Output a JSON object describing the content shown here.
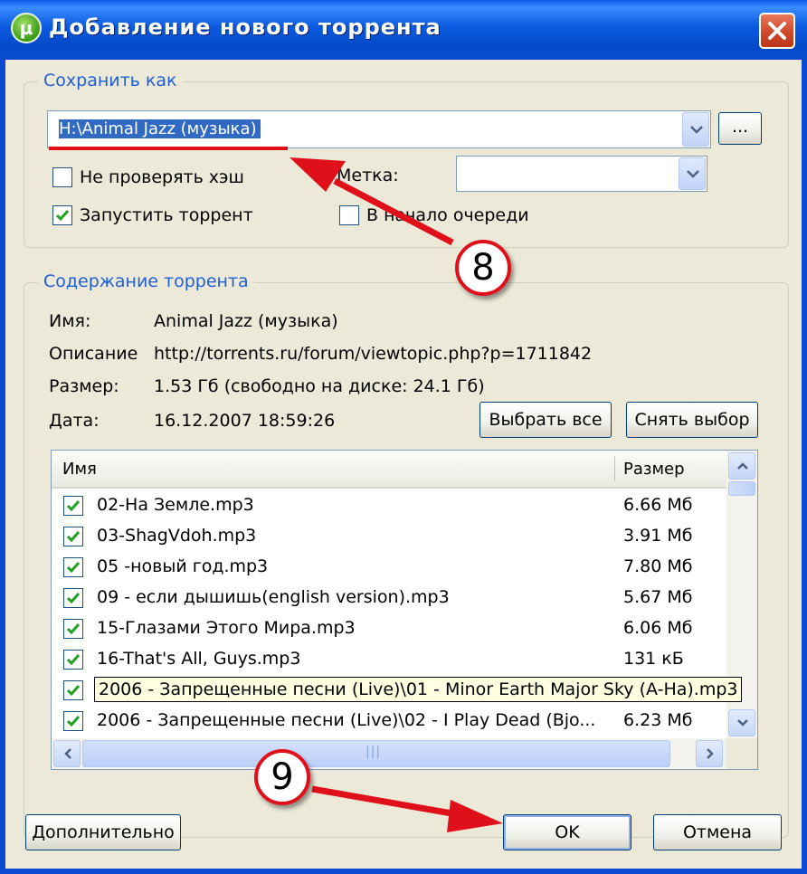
{
  "window": {
    "title": "Добавление нового торрента",
    "close_icon": "close-icon",
    "app_icon_glyph": "µ"
  },
  "save_as": {
    "legend": "Сохранить как",
    "path": "H:\\Animal Jazz (музыка)",
    "browse_label": "...",
    "skip_hash_label": "Не проверять хэш",
    "skip_hash_checked": false,
    "label_caption": "Метка:",
    "label_value": "",
    "start_torrent_label": "Запустить торрент",
    "start_torrent_checked": true,
    "queue_top_label": "В начало очереди",
    "queue_top_checked": false
  },
  "content": {
    "legend": "Содержание торрента",
    "name_caption": "Имя:",
    "name_value": "Animal Jazz (музыка)",
    "desc_caption": "Описание",
    "desc_value": "http://torrents.ru/forum/viewtopic.php?p=1711842",
    "size_caption": "Размер:",
    "size_value": "1.53 Гб (свободно на диске: 24.1 Гб)",
    "date_caption": "Дата:",
    "date_value": "16.12.2007 18:59:26",
    "select_all_label": "Выбрать все",
    "deselect_label": "Снять выбор"
  },
  "files": {
    "col_name": "Имя",
    "col_size": "Размер",
    "rows": [
      {
        "name": "02-На Земле.mp3",
        "size": "6.66 Мб",
        "checked": true
      },
      {
        "name": "03-ShagVdoh.mp3",
        "size": "3.91 Мб",
        "checked": true
      },
      {
        "name": "05 -новый год.mp3",
        "size": "7.80 Мб",
        "checked": true
      },
      {
        "name": "09 - если дышишь(english version).mp3",
        "size": "5.67 Мб",
        "checked": true
      },
      {
        "name": "15-Глазами Этого Мира.mp3",
        "size": "6.06 Мб",
        "checked": true
      },
      {
        "name": "16-That's All, Guys.mp3",
        "size": "131 кБ",
        "checked": true
      },
      {
        "name": "",
        "size": "",
        "checked": true
      },
      {
        "name": "2006 - Запрещенные песни (Live)\\02 - I Play Dead (Bjo...",
        "size": "6.23 Мб",
        "checked": true
      }
    ],
    "tooltip": "2006 - Запрещенные песни (Live)\\01 - Minor Earth Major Sky (A-Ha).mp3",
    "thumb_grip": "|||"
  },
  "buttons": {
    "advanced_label": "Дополнительно",
    "ok_label": "OK",
    "cancel_label": "Отмена"
  },
  "annotations": {
    "badge_8": "8",
    "badge_9": "9",
    "accent_color": "#e0101a"
  }
}
